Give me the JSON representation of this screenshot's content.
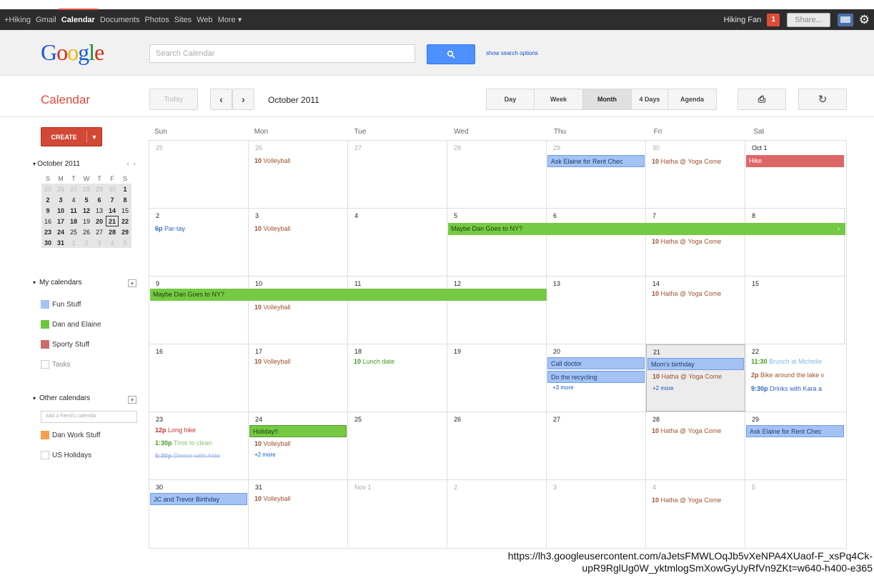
{
  "gbar": {
    "nav": [
      "+Hiking",
      "Gmail",
      "Calendar",
      "Documents",
      "Photos",
      "Sites",
      "Web",
      "More ▾"
    ],
    "user": "Hiking Fan",
    "notifications": "1",
    "share": "Share..."
  },
  "header": {
    "logo": [
      "G",
      "o",
      "o",
      "g",
      "l",
      "e"
    ],
    "search_placeholder": "Search Calendar",
    "search_options": "show search options"
  },
  "toolbar": {
    "title": "Calendar",
    "today": "Today",
    "prev": "‹",
    "next": "›",
    "month": "October 2011",
    "views": [
      "Day",
      "Week",
      "Month",
      "4 Days",
      "Agenda"
    ],
    "selected_view": "Month",
    "print": "⎙",
    "refresh": "↻"
  },
  "sidebar": {
    "create": "CREATE",
    "mini": {
      "title": "October 2011",
      "dow": [
        "S",
        "M",
        "T",
        "W",
        "T",
        "F",
        "S"
      ],
      "weeks": [
        [
          "25",
          "26",
          "27",
          "28",
          "29",
          "30",
          "1"
        ],
        [
          "2",
          "3",
          "4",
          "5",
          "6",
          "7",
          "8"
        ],
        [
          "9",
          "10",
          "11",
          "12",
          "13",
          "14",
          "15"
        ],
        [
          "16",
          "17",
          "18",
          "19",
          "20",
          "21",
          "22"
        ],
        [
          "23",
          "24",
          "25",
          "26",
          "27",
          "28",
          "29"
        ],
        [
          "30",
          "31",
          "1",
          "2",
          "3",
          "4",
          "5"
        ]
      ]
    },
    "my_calendars_title": "My calendars",
    "my_calendars": [
      {
        "name": "Fun Stuff",
        "color": "#a4c2f4"
      },
      {
        "name": "Dan and Elaine",
        "color": "#6fc63c"
      },
      {
        "name": "Sporty Stuff",
        "color": "#d16b6b"
      },
      {
        "name": "Tasks",
        "color": ""
      }
    ],
    "other_calendars_title": "Other calendars",
    "add_friend_placeholder": "Add a friend's calendar",
    "other_calendars": [
      {
        "name": "Dan Work Stuff",
        "color": "#f6a04d"
      },
      {
        "name": "US Holidays",
        "color": ""
      }
    ]
  },
  "month_grid": {
    "dow": [
      "Sun",
      "Mon",
      "Tue",
      "Wed",
      "Thu",
      "Fri",
      "Sat"
    ],
    "days": [
      [
        "25",
        "26",
        "27",
        "28",
        "29",
        "30",
        "Oct 1"
      ],
      [
        "2",
        "3",
        "4",
        "5",
        "6",
        "7",
        "8"
      ],
      [
        "9",
        "10",
        "11",
        "12",
        "13",
        "14",
        "15"
      ],
      [
        "16",
        "17",
        "18",
        "19",
        "20",
        "21",
        "22"
      ],
      [
        "23",
        "24",
        "25",
        "26",
        "27",
        "28",
        "29"
      ],
      [
        "30",
        "31",
        "Nov 1",
        "2",
        "3",
        "4",
        "5"
      ]
    ],
    "events": {
      "volleyball_time": "10",
      "volleyball": "Volleyball",
      "yoga_time": "10",
      "yoga": "Hatha @ Yoga Come",
      "rent_check": "Ask Elaine for Rent Chec",
      "hike": "Hike",
      "party_time": "6p",
      "party": "Par-tay",
      "ny_trip": "Maybe Dan Goes to NY?",
      "lunch_time": "10",
      "lunch": "Lunch date",
      "call_doctor": "Call doctor",
      "recycling": "Do the recycling",
      "more3": "+3 more",
      "moms_birthday": "Mom's birthday",
      "more2": "+2 more",
      "brunch_time": "11:30",
      "brunch": "Brunch at Michelle",
      "bike_time": "2p",
      "bike": "Bike around the lake v",
      "drinks_time": "9:30p",
      "drinks": "Drinks with Kara a",
      "long_hike_time": "12p",
      "long_hike": "Long hike",
      "clean_time": "1:30p",
      "clean": "Time to clean",
      "dinner_time": "6:30p",
      "dinner": "Dinner with Aldo",
      "holiday": "Holiday!!",
      "birthday_30": "JC and Trevor Birthday"
    }
  },
  "footer_url": [
    "https://lh3.googleusercontent.com/aJetsFMWLOqJb5vXeNPA4XUaof-F_xsPq4Ck-",
    "upR9RglUg0W_yktmlogSmXowGyUyRfVn9ZKt=w640-h400-e365"
  ]
}
